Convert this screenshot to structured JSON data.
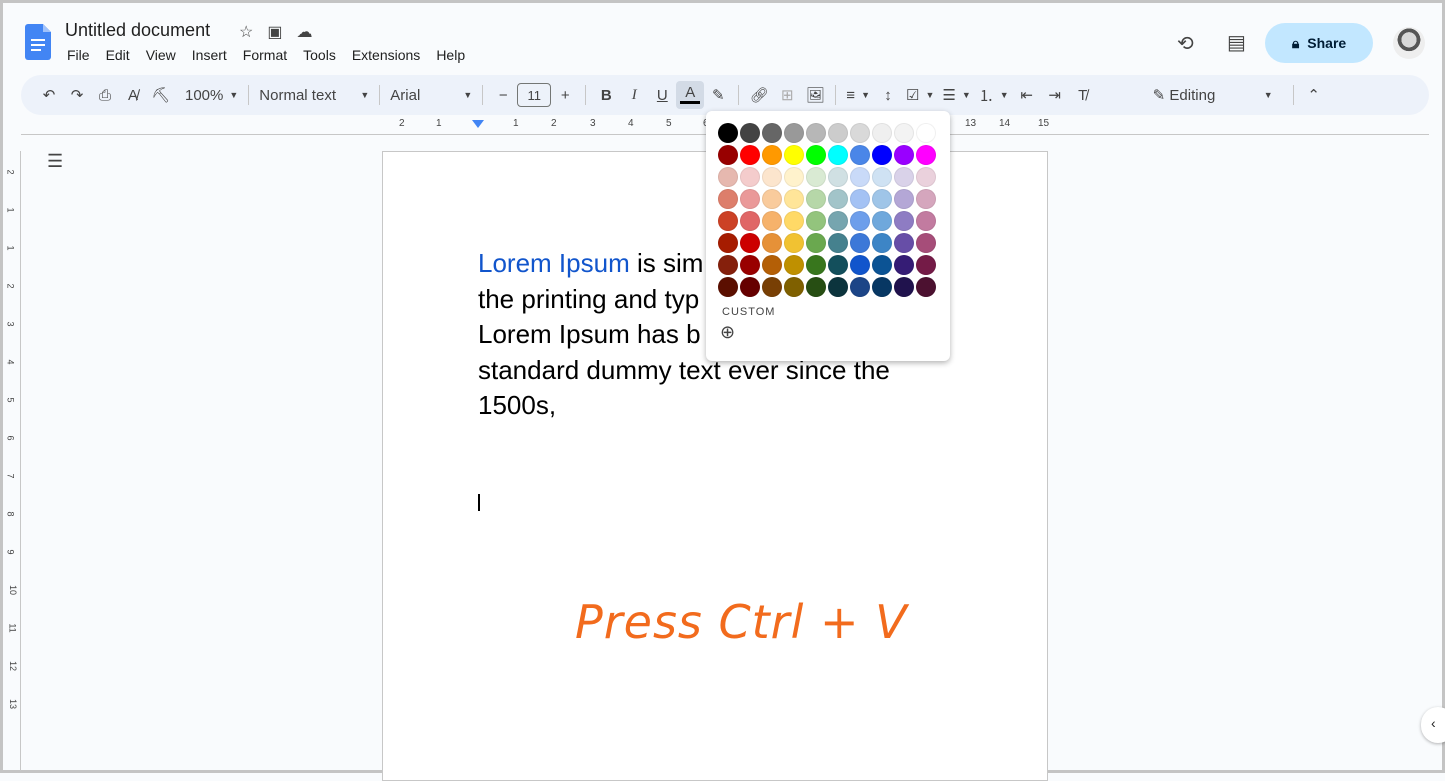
{
  "header": {
    "title": "Untitled document",
    "menu": [
      "File",
      "Edit",
      "View",
      "Insert",
      "Format",
      "Tools",
      "Extensions",
      "Help"
    ],
    "share_label": "Share"
  },
  "toolbar": {
    "zoom": "100%",
    "style": "Normal text",
    "font": "Arial",
    "font_size": "11",
    "mode": "Editing"
  },
  "ruler": {
    "ticks": [
      "2",
      "1",
      "1",
      "2",
      "3",
      "4",
      "5",
      "6",
      "13",
      "14",
      "15"
    ]
  },
  "vruler": [
    "2",
    "1",
    "1",
    "2",
    "3",
    "4",
    "5",
    "6",
    "7",
    "8",
    "9",
    "10",
    "11",
    "12",
    "13"
  ],
  "document": {
    "line1_link": "Lorem Ipsum",
    "line1_rest": " is sim",
    "line2": "the printing and typ",
    "line3": "Lorem Ipsum has b",
    "line4": "standard dummy text ever since the",
    "line5": "1500s,",
    "annotation": "Press Ctrl + V"
  },
  "palette": {
    "custom_label": "CUSTOM",
    "colors": [
      [
        "#000000",
        "#434343",
        "#666666",
        "#999999",
        "#b7b7b7",
        "#cccccc",
        "#d9d9d9",
        "#efefef",
        "#f3f3f3",
        "#ffffff"
      ],
      [
        "#980000",
        "#ff0000",
        "#ff9900",
        "#ffff00",
        "#00ff00",
        "#00ffff",
        "#4a86e8",
        "#0000ff",
        "#9900ff",
        "#ff00ff"
      ],
      [
        "#e6b8af",
        "#f4cccc",
        "#fce5cd",
        "#fff2cc",
        "#d9ead3",
        "#d0e0e3",
        "#c9daf8",
        "#cfe2f3",
        "#d9d2e9",
        "#ead1dc"
      ],
      [
        "#dd7e6b",
        "#ea9999",
        "#f9cb9c",
        "#ffe599",
        "#b6d7a8",
        "#a2c4c9",
        "#a4c2f4",
        "#9fc5e8",
        "#b4a7d6",
        "#d5a6bd"
      ],
      [
        "#cc4125",
        "#e06666",
        "#f6b26b",
        "#ffd966",
        "#93c47d",
        "#76a5af",
        "#6d9eeb",
        "#6fa8dc",
        "#8e7cc3",
        "#c27ba0"
      ],
      [
        "#a61c00",
        "#cc0000",
        "#e69138",
        "#f1c232",
        "#6aa84f",
        "#45818e",
        "#3c78d8",
        "#3d85c6",
        "#674ea7",
        "#a64d79"
      ],
      [
        "#85200c",
        "#990000",
        "#b45f06",
        "#bf9000",
        "#38761d",
        "#134f5c",
        "#1155cc",
        "#0b5394",
        "#351c75",
        "#741b47"
      ],
      [
        "#5b0f00",
        "#660000",
        "#783f04",
        "#7f6000",
        "#274e13",
        "#0c343d",
        "#1c4587",
        "#073763",
        "#20124d",
        "#4c1130"
      ]
    ]
  },
  "colors": {
    "accent": "#0b57d0",
    "share_bg": "#c2e7ff",
    "link": "#1155cc",
    "annotation": "#f26b1d"
  }
}
